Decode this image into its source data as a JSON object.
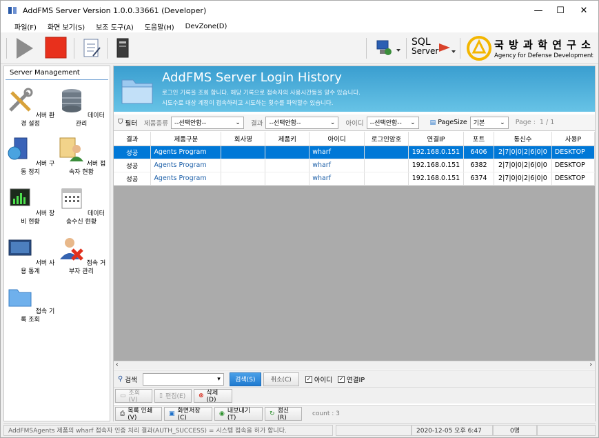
{
  "window": {
    "title": "AddFMS Server Version 1.0.0.33661 (Developer)"
  },
  "menu": [
    "파일(F)",
    "화면 보기(S)",
    "보조 도구(A)",
    "도움말(H)",
    "DevZone(D)"
  ],
  "toolbar": {
    "sql_label_top": "SQL",
    "sql_label_bottom": "Server",
    "org_name": "국 방 과 학 연 구 소",
    "org_name_en": "Agency for Defense Development"
  },
  "sidebar": {
    "title": "Server Management",
    "items": [
      {
        "label": "서버 환경 설정",
        "icon": "tools-icon"
      },
      {
        "label": "데이터 관리",
        "icon": "database-icon"
      },
      {
        "label": "서버 구동 정지",
        "icon": "server-globe-icon"
      },
      {
        "label": "서버 접속자 현황",
        "icon": "user-document-icon"
      },
      {
        "label": "서버 장비 현황",
        "icon": "monitor-chart-icon"
      },
      {
        "label": "데이터 송수신 현황",
        "icon": "calendar-icon"
      },
      {
        "label": "서버 사용 통계",
        "icon": "screen-icon"
      },
      {
        "label": "접속 거부자 관리",
        "icon": "user-block-icon"
      },
      {
        "label": "접속 기록 조회",
        "icon": "folder-icon"
      }
    ]
  },
  "banner": {
    "title": "AddFMS Server Login History",
    "line1": "로그인 기록을 조회 합니다. 해당 기록으로 접속자의 사용시간등을 알수 있습니다.",
    "line2": "시도수로 대상 계정이 접속하려고 시도하는 횟수를 파악할수 있습니다."
  },
  "filter": {
    "filter_label": "필터",
    "product_type_label": "제품종류",
    "product_type_value": "--선택안함--",
    "result_label": "결과",
    "result_value": "--선택안함--",
    "id_label": "아이디",
    "id_value": "--선택안함--",
    "pagesize_label": "PageSize",
    "pagesize_value": "기본",
    "page_label": "Page :",
    "page_value": "1  / 1"
  },
  "table": {
    "columns": [
      "결과",
      "제품구분",
      "회사명",
      "제품키",
      "아이디",
      "로그인암호",
      "연결IP",
      "포트",
      "통신수",
      "사용P"
    ],
    "rows": [
      [
        "성공",
        "Agents Program",
        "",
        "",
        "wharf",
        "",
        "192.168.0.151",
        "6406",
        "2|7|0|0|2|6|0|0",
        "DESKTOP"
      ],
      [
        "성공",
        "Agents Program",
        "",
        "",
        "wharf",
        "",
        "192.168.0.151",
        "6382",
        "2|7|0|0|2|6|0|0",
        "DESKTOP"
      ],
      [
        "성공",
        "Agents Program",
        "",
        "",
        "wharf",
        "",
        "192.168.0.151",
        "6374",
        "2|7|0|0|2|6|0|0",
        "DESKTOP"
      ]
    ]
  },
  "search": {
    "label": "검색",
    "search_button": "검색(S)",
    "cancel_button": "취소(C)",
    "check_id": "아이디",
    "check_ip": "연결IP"
  },
  "actions": {
    "view": "조회(V)",
    "edit": "편집(E)",
    "delete": "삭제(D)"
  },
  "export": {
    "print": "목록 인쇄(V)",
    "save_screen": "화면저장(C)",
    "export": "내보내기(T)",
    "refresh": "갱신(R)",
    "count": "count : 3"
  },
  "status": {
    "message": "AddFMSAgents 제품의 wharf 접속자 인증 처리 결과(AUTH_SUCCESS) = 시스템 접속을 허가 합니다.",
    "datetime": "2020-12-05 오후 6:47",
    "count": "0명"
  }
}
